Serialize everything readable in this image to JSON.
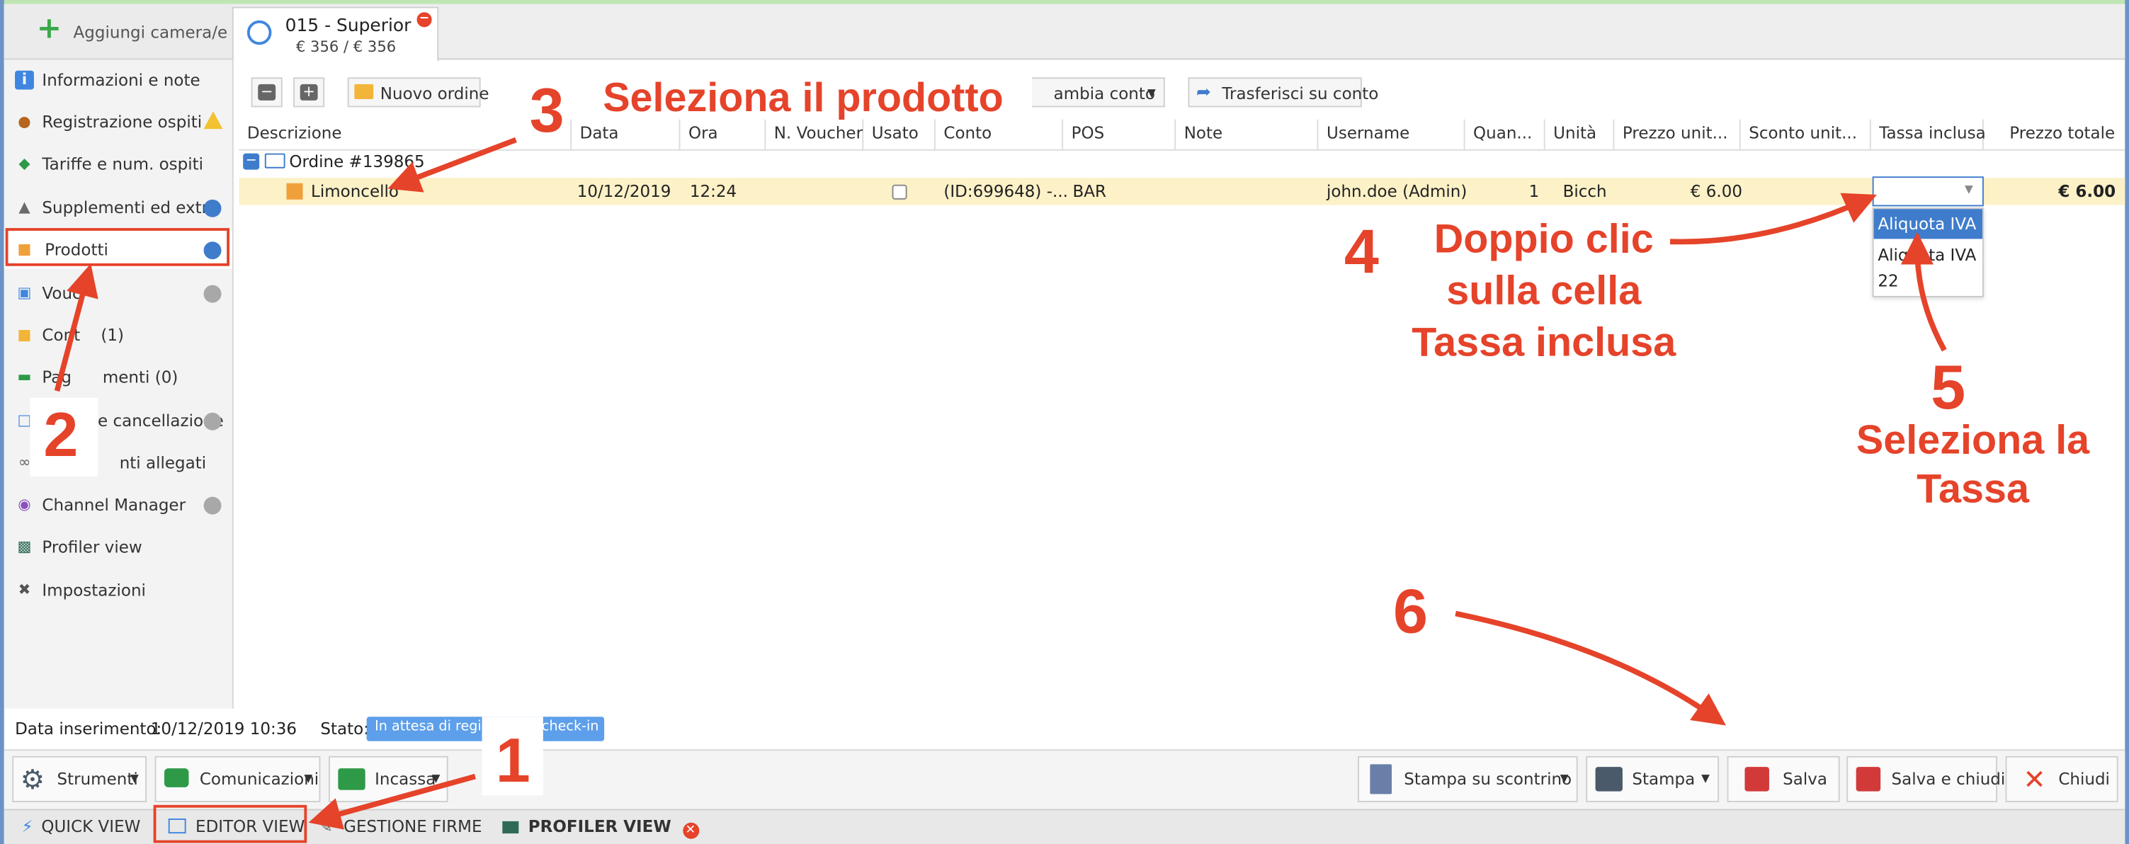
{
  "sidebar": {
    "add_label": "Aggiungi camera/e",
    "items": [
      {
        "label": "Informazioni e note",
        "icon": "info-icon"
      },
      {
        "label": "Registrazione ospiti",
        "icon": "guest-icon"
      },
      {
        "label": "Tariffe e num. ospiti",
        "icon": "tag-icon"
      },
      {
        "label": "Supplementi ed extra",
        "icon": "bell-icon"
      },
      {
        "label": "Prodotti",
        "icon": "boxes-icon"
      },
      {
        "label": "Vouc",
        "icon": "voucher-icon"
      },
      {
        "label": "Cont    (1)",
        "icon": "folder-icon"
      },
      {
        "label": "Pag      menti (0)",
        "icon": "money-icon"
      },
      {
        "label": "e cancellazione",
        "icon": "document-icon"
      },
      {
        "label": "nti allegati",
        "icon": "paperclip-icon"
      },
      {
        "label": "Channel Manager",
        "icon": "broadcast-icon"
      },
      {
        "label": "Profiler view",
        "icon": "monitor-icon"
      },
      {
        "label": "Impostazioni",
        "icon": "tools-icon"
      }
    ]
  },
  "room_tab": {
    "title": "015 - Superior",
    "subtitle": "€ 356 / € 356"
  },
  "toolbar": {
    "new_order": "Nuovo ordine",
    "change_account": "ambia conto",
    "transfer": "Trasferisci su conto"
  },
  "table": {
    "headers": [
      "Descrizione",
      "Data",
      "Ora",
      "N. Voucher",
      "Usato",
      "Conto",
      "POS",
      "Note",
      "Username",
      "Quan...",
      "Unità",
      "Prezzo unit...",
      "Sconto unit...",
      "Tassa inclusa",
      "Prezzo totale"
    ],
    "order_label": "Ordine #139865",
    "row": {
      "desc": "Limoncello",
      "date": "10/12/2019",
      "time": "12:24",
      "account": "(ID:699648) -...",
      "pos": "BAR",
      "username": "john.doe (Admin)",
      "qty": "1",
      "unit": "Bicch",
      "unit_price": "€ 6.00",
      "total": "€ 6.00"
    },
    "tax_options": [
      "Aliquota IVA",
      "Aliquota IVA 22"
    ]
  },
  "status": {
    "date_label": "Data inserimento:",
    "date_value": "10/12/2019 10:36",
    "state_label": "Stato:",
    "state_left": "In attesa di regis",
    "state_right": "check-in"
  },
  "bottom": {
    "tools": "Strumenti",
    "comms": "Comunicazioni",
    "cashin": "Incassa",
    "receipt": "Stampa su scontrino",
    "print": "Stampa",
    "save": "Salva",
    "save_close": "Salva e chiudi",
    "close": "Chiudi"
  },
  "nav": {
    "quick": "QUICK VIEW",
    "editor": "EDITOR VIEW",
    "signatures": "GESTIONE FIRME",
    "profiler": "PROFILER VIEW"
  },
  "annotations": {
    "n1": "1",
    "n2": "2",
    "n3": "3",
    "t3": "Seleziona il prodotto",
    "n4": "4",
    "t4a": "Doppio clic",
    "t4b": "sulla cella",
    "t4c": "Tassa inclusa",
    "n5": "5",
    "t5a": "Seleziona la",
    "t5b": "Tassa",
    "n6": "6"
  },
  "colors": {
    "accent": "#e5432a",
    "blue": "#3f7ccc",
    "highlight": "#fdf1c8"
  }
}
